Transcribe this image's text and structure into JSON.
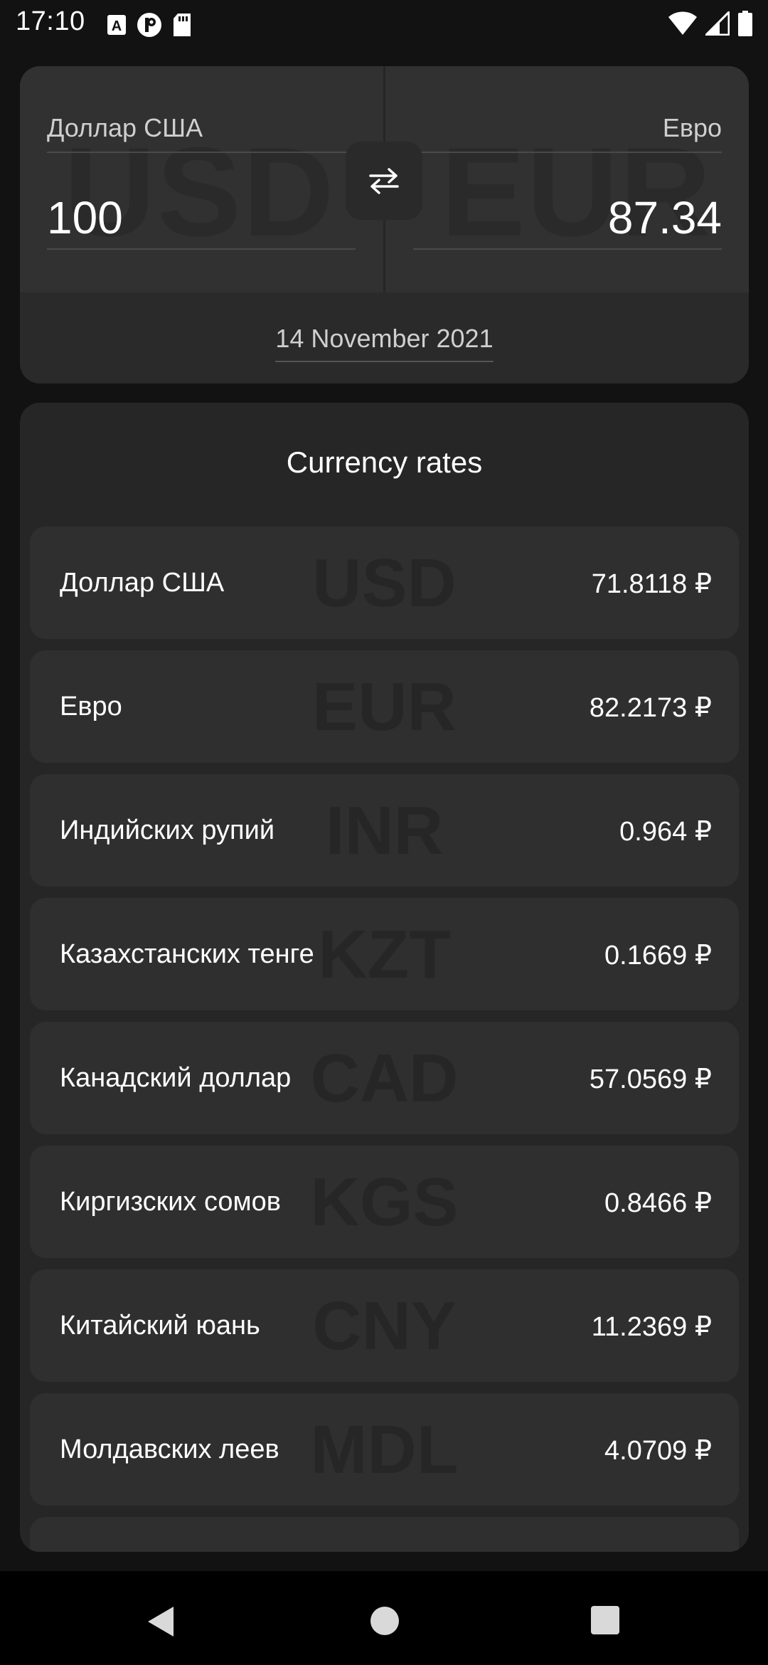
{
  "status_bar": {
    "time": "17:10"
  },
  "converter": {
    "from": {
      "code": "USD",
      "name": "Доллар США",
      "amount": "100"
    },
    "to": {
      "code": "EUR",
      "name": "Евро",
      "amount": "87.34"
    },
    "date": "14 November 2021"
  },
  "rates": {
    "title": "Currency rates",
    "items": [
      {
        "code": "USD",
        "name": "Доллар США",
        "value": "71.8118 ₽"
      },
      {
        "code": "EUR",
        "name": "Евро",
        "value": "82.2173 ₽"
      },
      {
        "code": "INR",
        "name": "Индийских рупий",
        "value": "0.964 ₽"
      },
      {
        "code": "KZT",
        "name": "Казахстанских тенге",
        "value": "0.1669 ₽"
      },
      {
        "code": "CAD",
        "name": "Канадский доллар",
        "value": "57.0569 ₽"
      },
      {
        "code": "KGS",
        "name": "Киргизских сомов",
        "value": "0.8466 ₽"
      },
      {
        "code": "CNY",
        "name": "Китайский юань",
        "value": "11.2369 ₽"
      },
      {
        "code": "MDL",
        "name": "Молдавских леев",
        "value": "4.0709 ₽"
      },
      {
        "code": "",
        "name": "",
        "value": ""
      }
    ]
  },
  "icons": {
    "swap": "swap-arrows-icon",
    "back": "nav-back-icon",
    "home": "nav-home-icon",
    "recents": "nav-recents-icon"
  },
  "colors": {
    "background": "#121212",
    "card": "#2a2a2a",
    "row": "#2f2f2f",
    "text": "#ffffff"
  }
}
